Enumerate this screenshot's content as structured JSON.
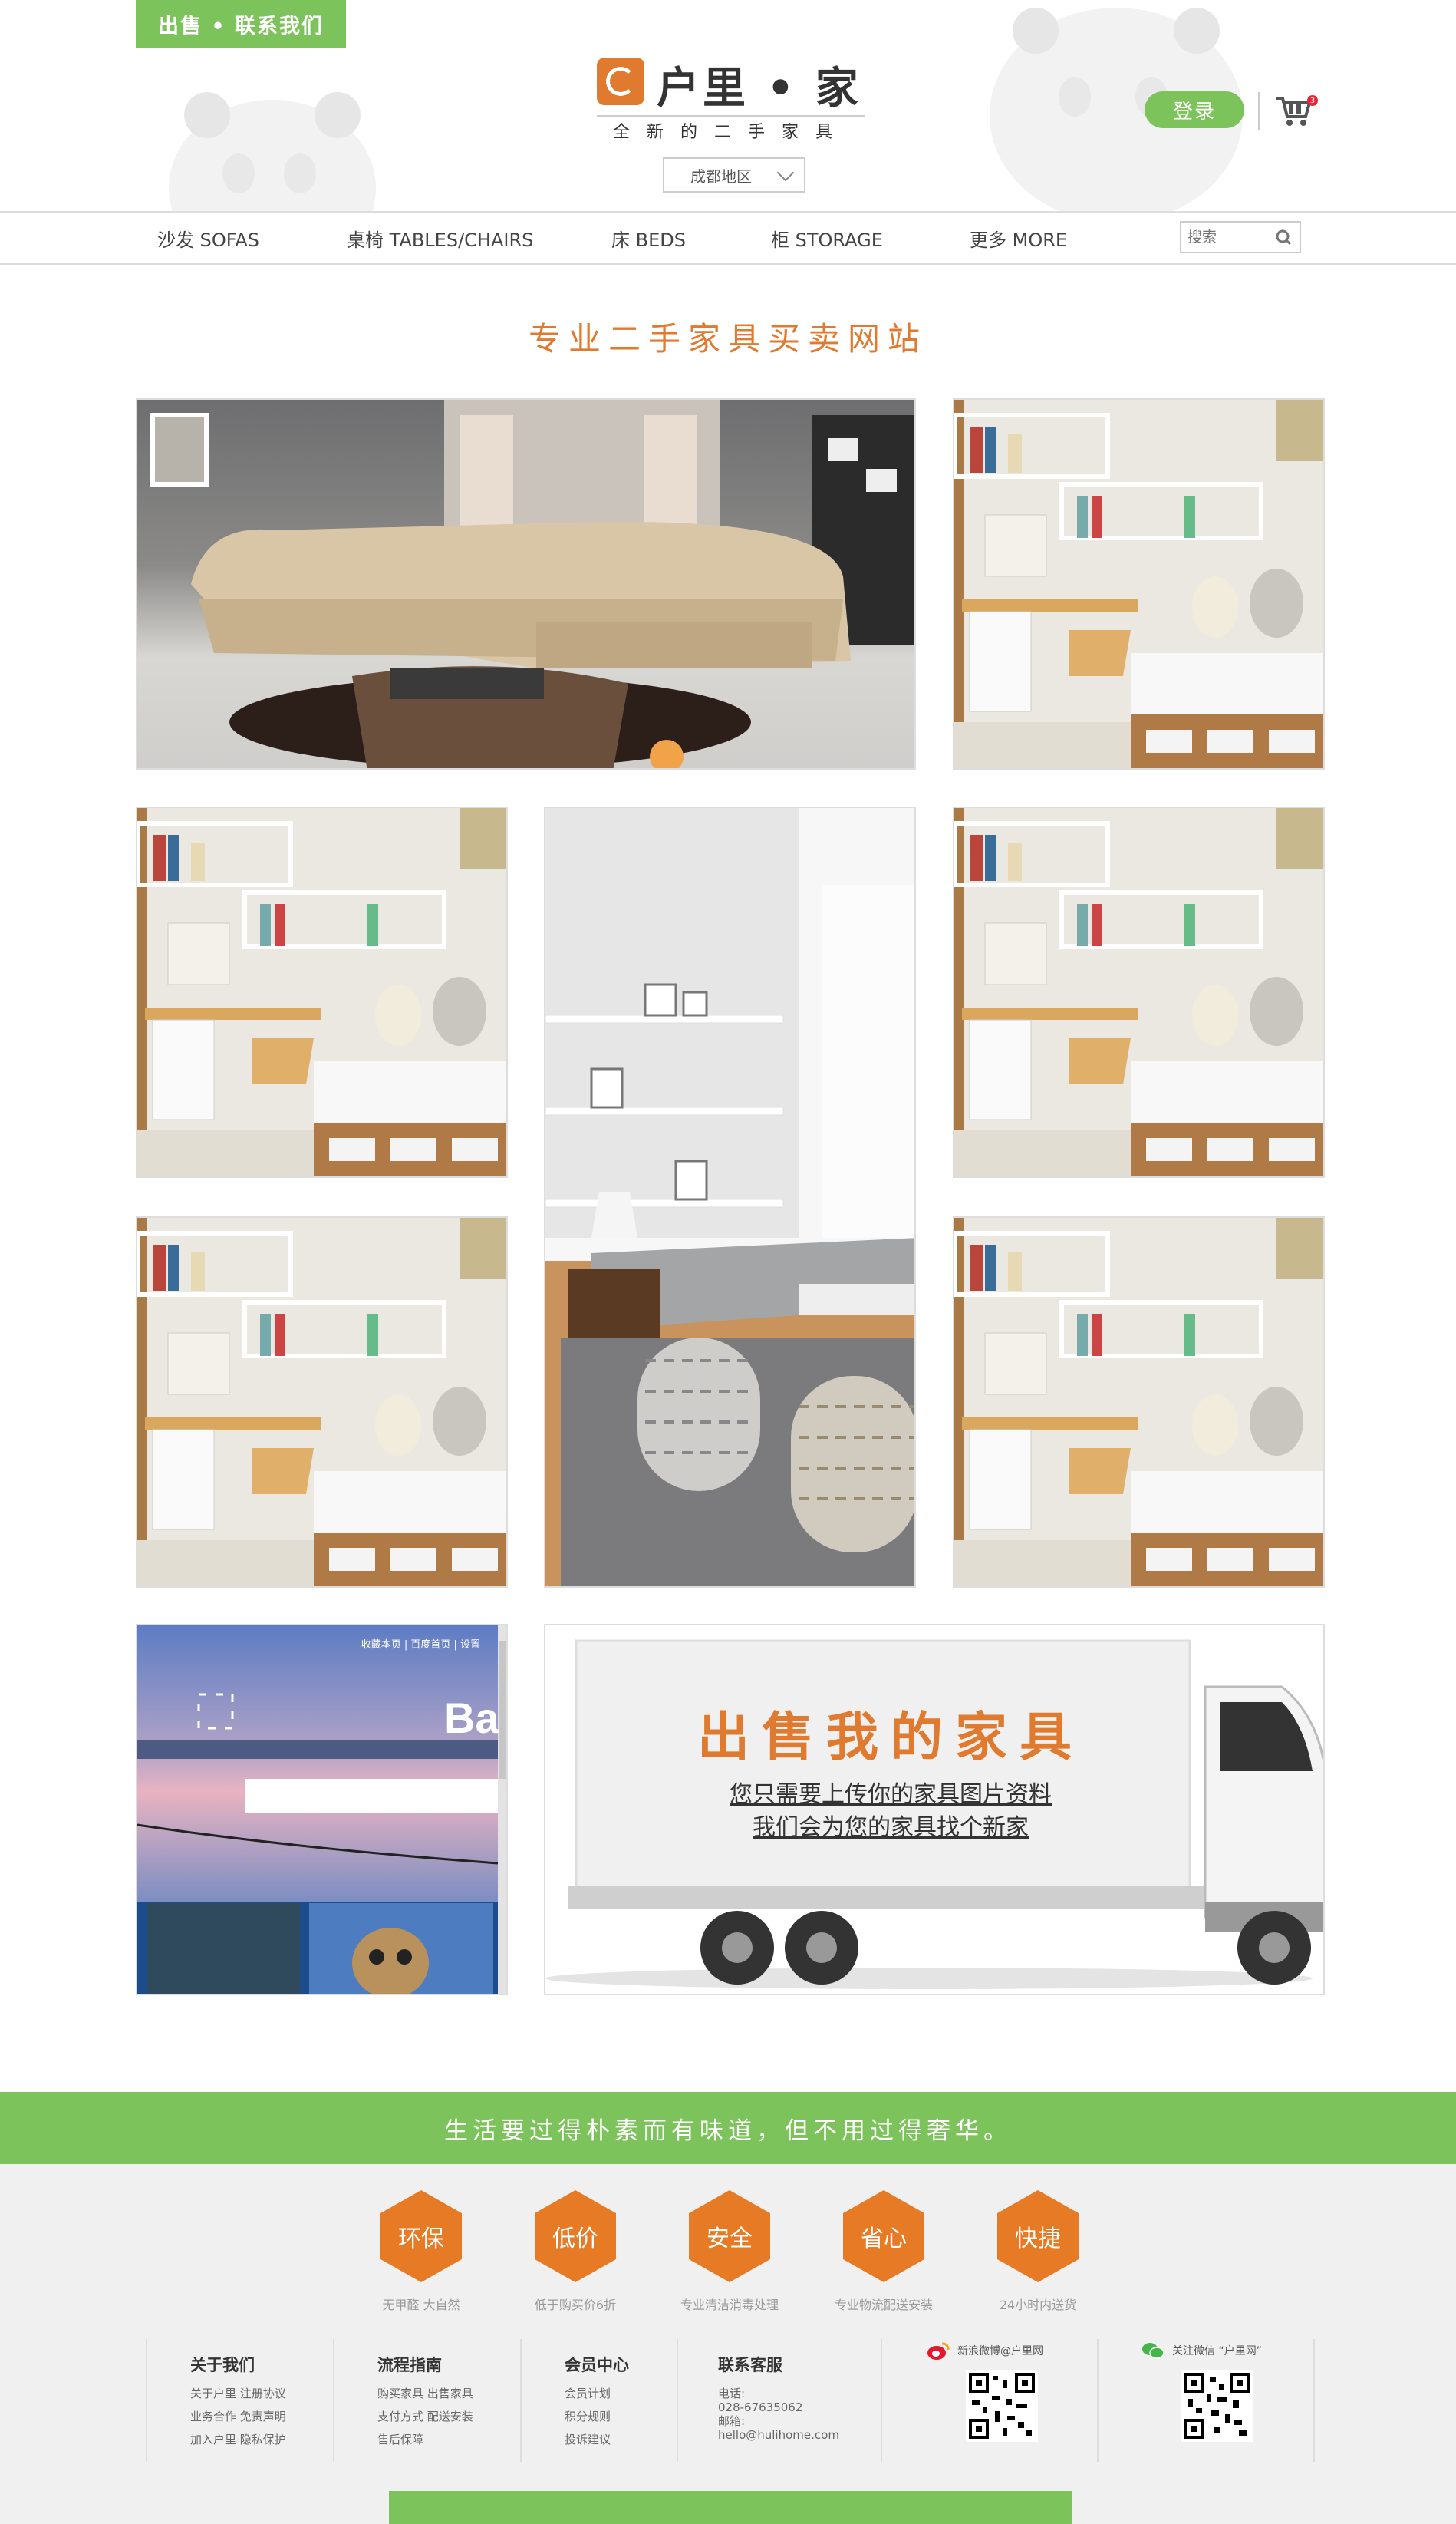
{
  "header": {
    "sell_contact": "出售 • 联系我们",
    "logo_title": "户里 • 家",
    "logo_subtitle": "全新的二手家具",
    "region": "成都地区",
    "login": "登录",
    "cart_count": "3"
  },
  "nav": {
    "items": [
      {
        "label": "沙发   SOFAS"
      },
      {
        "label": "桌椅   TABLES/CHAIRS"
      },
      {
        "label": "床   BEDS"
      },
      {
        "label": "柜   STORAGE"
      },
      {
        "label": "更多   MORE"
      }
    ],
    "search_placeholder": "搜索"
  },
  "main": {
    "title": "专业二手家具买卖网站",
    "sell_banner": {
      "title": "出售我的家具",
      "line1": "您只需要上传你的家具图片资料",
      "line2": "我们会为您的家具找个新家"
    },
    "browser_tile": {
      "links": "收藏本页 | 百度首页 | 设置"
    }
  },
  "slogan": "生活要过得朴素而有味道，但不用过得奢华。",
  "features": [
    {
      "badge": "环保",
      "caption": "无甲醛 大自然"
    },
    {
      "badge": "低价",
      "caption": "低于购买价6折"
    },
    {
      "badge": "安全",
      "caption": "专业清洁消毒处理"
    },
    {
      "badge": "省心",
      "caption": "专业物流配送安装"
    },
    {
      "badge": "快捷",
      "caption": "24小时内送货"
    }
  ],
  "footer": {
    "about": {
      "title": "关于我们",
      "line1": "关于户里  注册协议",
      "line2": "业务合作  免责声明",
      "line3": "加入户里  隐私保护"
    },
    "guide": {
      "title": "流程指南",
      "line1": "购买家具  出售家具",
      "line2": "支付方式  配送安装",
      "line3": "售后保障"
    },
    "member": {
      "title": "会员中心",
      "line1": "会员计划",
      "line2": "积分规则",
      "line3": "投诉建议"
    },
    "contact": {
      "title": "联系客服",
      "line1": "电话:",
      "line2": "028-67635062",
      "line3": "邮箱:",
      "line4": "hello@hulihome.com"
    },
    "weibo": "新浪微博@户里网",
    "wechat": "关注微信 “户里网”"
  },
  "colors": {
    "green": "#7dc35b",
    "orange": "#e07a2f"
  }
}
